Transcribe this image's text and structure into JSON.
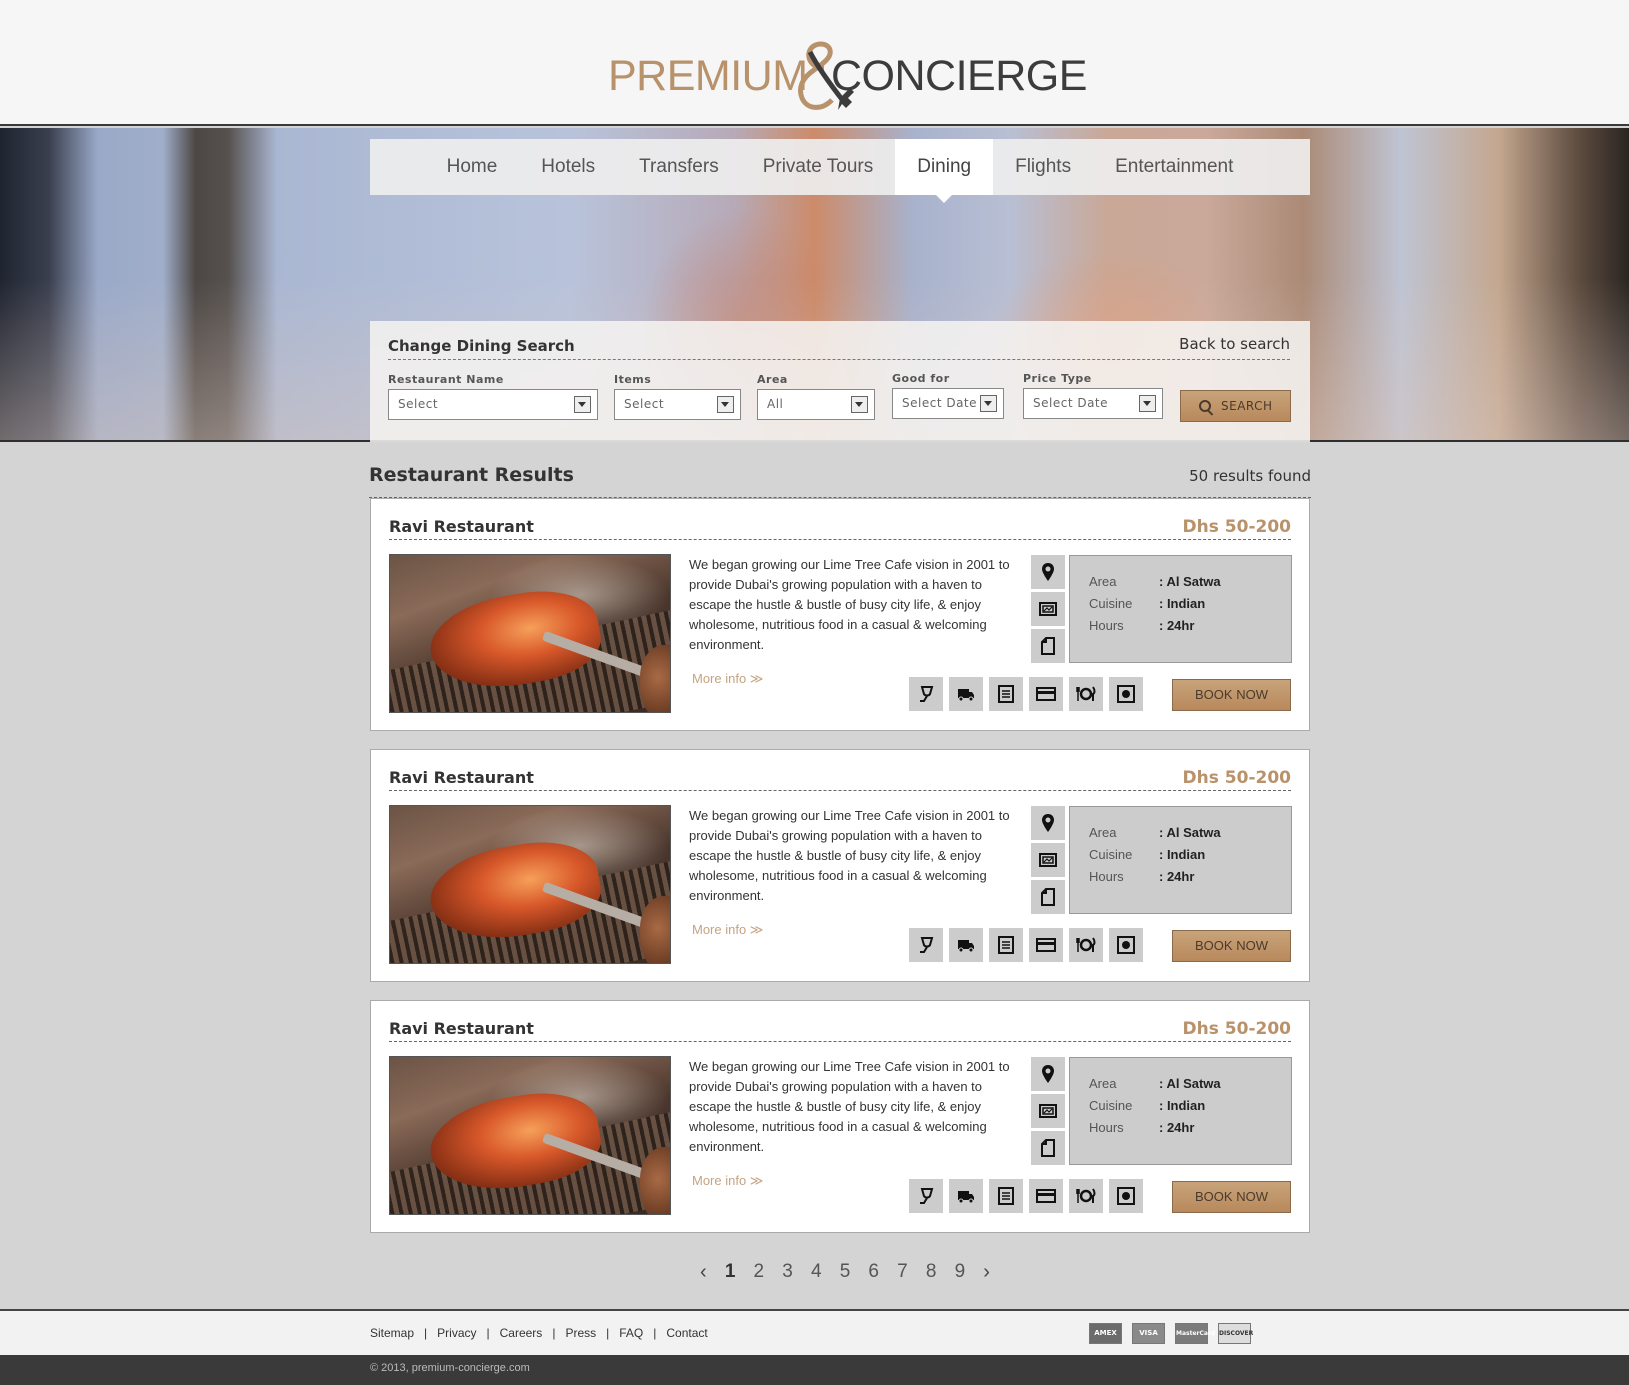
{
  "brand": {
    "word1": "PREMIUM",
    "word2": "CONCIERGE",
    "colors": {
      "gold": "#b8926a",
      "dark": "#3c3c3c"
    }
  },
  "nav": {
    "items": [
      {
        "label": "Home"
      },
      {
        "label": "Hotels"
      },
      {
        "label": "Transfers"
      },
      {
        "label": "Private Tours"
      },
      {
        "label": "Dining"
      },
      {
        "label": "Flights"
      },
      {
        "label": "Entertainment"
      }
    ],
    "active": "Dining"
  },
  "search": {
    "title": "Change Dining Search",
    "back_label": "Back to search",
    "fields": [
      {
        "label": "Restaurant Name",
        "value": "Select"
      },
      {
        "label": "Items",
        "value": "Select"
      },
      {
        "label": "Area",
        "value": "All"
      },
      {
        "label": "Good for",
        "value": "Select Date"
      },
      {
        "label": "Price Type",
        "value": "Select Date"
      }
    ],
    "button_label": "SEARCH"
  },
  "results": {
    "title": "Restaurant Results",
    "count_text": "50 results found",
    "items": [
      {
        "name": "Ravi Restaurant",
        "price": "Dhs 50-200",
        "description": "We began growing our Lime Tree Cafe vision in 2001 to provide Dubai's growing population with a haven to escape the hustle & bustle of busy city life, & enjoy wholesome, nutritious food in a casual & welcoming environment.",
        "more_label": "More info ≫",
        "info": [
          {
            "key": "Area",
            "value": ": Al Satwa"
          },
          {
            "key": "Cuisine",
            "value": ": Indian"
          },
          {
            "key": "Hours",
            "value": ": 24hr"
          }
        ],
        "book_label": "BOOK NOW"
      },
      {
        "name": "Ravi Restaurant",
        "price": "Dhs 50-200",
        "description": "We began growing our Lime Tree Cafe vision in 2001 to provide Dubai's growing population with a haven to escape the hustle & bustle of busy city life, & enjoy wholesome, nutritious food in a casual & welcoming environment.",
        "more_label": "More info ≫",
        "info": [
          {
            "key": "Area",
            "value": ": Al Satwa"
          },
          {
            "key": "Cuisine",
            "value": ": Indian"
          },
          {
            "key": "Hours",
            "value": ": 24hr"
          }
        ],
        "book_label": "BOOK NOW"
      },
      {
        "name": "Ravi Restaurant",
        "price": "Dhs 50-200",
        "description": "We began growing our Lime Tree Cafe vision in 2001 to provide Dubai's growing population with a haven to escape the hustle & bustle of busy city life, & enjoy wholesome, nutritious food in a casual & welcoming environment.",
        "more_label": "More info ≫",
        "info": [
          {
            "key": "Area",
            "value": ": Al Satwa"
          },
          {
            "key": "Cuisine",
            "value": ": Indian"
          },
          {
            "key": "Hours",
            "value": ": 24hr"
          }
        ],
        "book_label": "BOOK NOW"
      }
    ],
    "side_icons": [
      "map-pin-icon",
      "gallery-icon",
      "document-icon"
    ],
    "feature_icons": [
      "wine-icon",
      "delivery-truck-icon",
      "menu-list-icon",
      "credit-card-icon",
      "dining-icon",
      "record-icon"
    ]
  },
  "pagination": {
    "prev": "‹",
    "pages": [
      "1",
      "2",
      "3",
      "4",
      "5",
      "6",
      "7",
      "8",
      "9"
    ],
    "current": "1",
    "next": "›"
  },
  "footer": {
    "links": [
      "Sitemap",
      "Privacy",
      "Careers",
      "Press",
      "FAQ",
      "Contact"
    ],
    "cards": [
      {
        "name": "AMEX",
        "color": "#6b6b6b"
      },
      {
        "name": "VISA",
        "color": "#8a8a8a"
      },
      {
        "name": "MasterCard",
        "color": "#7a7a7a"
      },
      {
        "name": "DISCOVER",
        "color": "#dddddd"
      }
    ],
    "copyright": "© 2013, premium-concierge.com"
  }
}
